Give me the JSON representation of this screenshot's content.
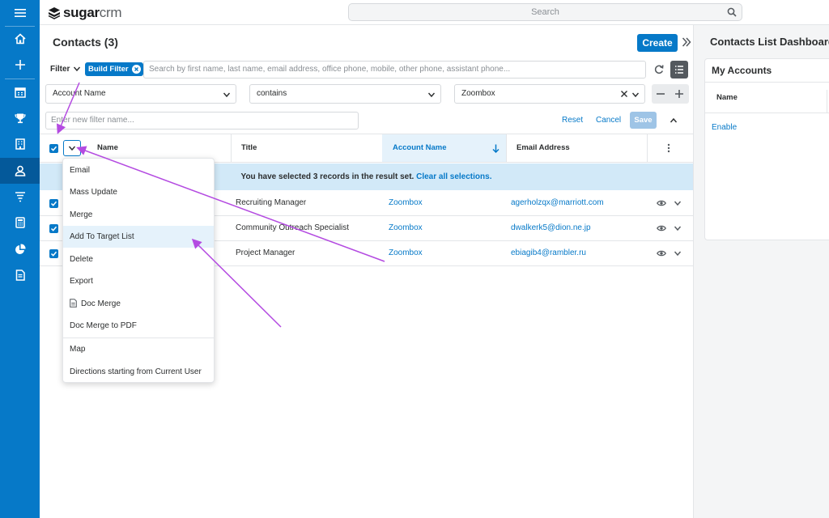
{
  "app": {
    "logo_bold": "sugar",
    "logo_light": "crm"
  },
  "search": {
    "placeholder": "Search"
  },
  "nav": [
    "menu-icon",
    "home-icon",
    "plus-icon",
    "calendar-icon",
    "trophy-icon",
    "building-icon",
    "contacts-icon",
    "funnel-icon",
    "calculator-icon",
    "pie-chart-icon",
    "document-icon"
  ],
  "page": {
    "title": "Contacts (3)",
    "create_label": "Create"
  },
  "filter": {
    "label": "Filter",
    "build_filter": "Build Filter",
    "search_placeholder": "Search by first name, last name, email address, office phone, mobile, other phone, assistant phone...",
    "field": "Account Name",
    "operator": "contains",
    "value": "Zoombox",
    "name_placeholder": "Enter new filter name...",
    "reset": "Reset",
    "cancel": "Cancel",
    "save": "Save"
  },
  "table": {
    "columns": [
      "Name",
      "Title",
      "Account Name",
      "Email Address"
    ],
    "banner_text": "You have selected 3 records in the result set.",
    "banner_link": "Clear all selections.",
    "rows": [
      {
        "title": "Recruiting Manager",
        "account": "Zoombox",
        "email": "agerholzqx@marriott.com"
      },
      {
        "title": "Community Outreach Specialist",
        "account": "Zoombox",
        "email": "dwalkerk5@dion.ne.jp"
      },
      {
        "title": "Project Manager",
        "account": "Zoombox",
        "email": "ebiagib4@rambler.ru"
      }
    ]
  },
  "mass_actions": [
    "Email",
    "Mass Update",
    "Merge",
    "Add To Target List",
    "Delete",
    "Export",
    "Doc Merge",
    "Doc Merge to PDF",
    "Map",
    "Directions starting from Current User"
  ],
  "colors": {
    "brand": "#0679c8",
    "nav_active": "#04599a",
    "annotation": "#b44be1"
  },
  "dashboard": {
    "title": "Contacts List Dashboard",
    "dashlet_title": "My Accounts",
    "column": "Name",
    "enable": "Enable"
  }
}
